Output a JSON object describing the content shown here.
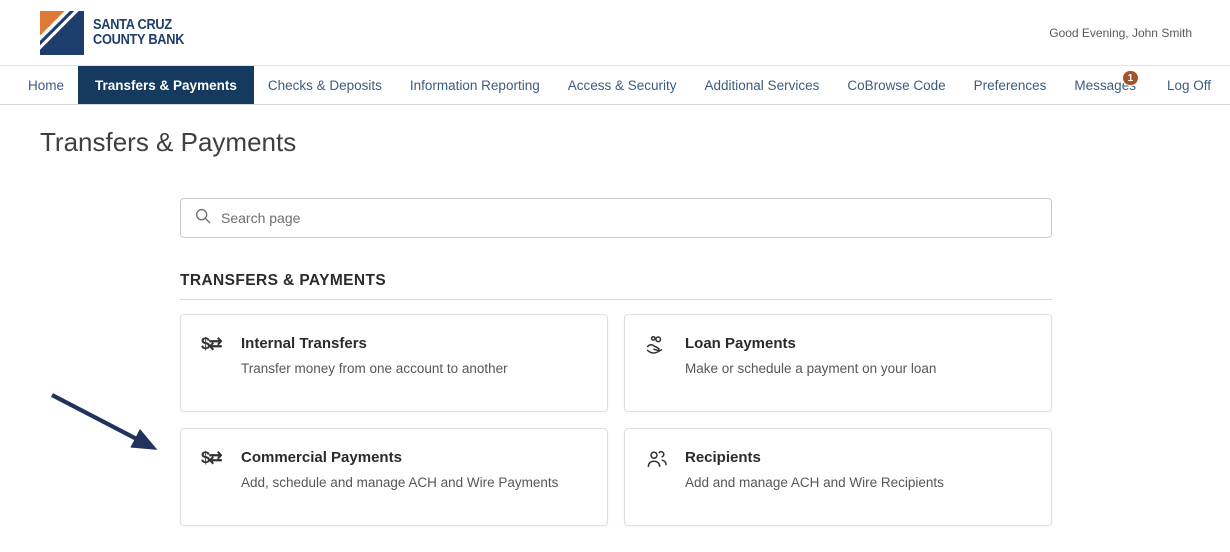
{
  "header": {
    "logo": {
      "line1": "SANTA CRUZ",
      "line2": "COUNTY BANK"
    },
    "greeting": "Good Evening, John Smith"
  },
  "nav": {
    "items": [
      {
        "label": "Home",
        "active": false
      },
      {
        "label": "Transfers & Payments",
        "active": true
      },
      {
        "label": "Checks & Deposits",
        "active": false
      },
      {
        "label": "Information Reporting",
        "active": false
      },
      {
        "label": "Access & Security",
        "active": false
      },
      {
        "label": "Additional Services",
        "active": false
      },
      {
        "label": "CoBrowse Code",
        "active": false
      },
      {
        "label": "Preferences",
        "active": false
      },
      {
        "label": "Messages",
        "active": false,
        "badge": "1"
      },
      {
        "label": "Log Off",
        "active": false
      }
    ]
  },
  "page": {
    "title": "Transfers & Payments"
  },
  "search": {
    "placeholder": "Search page"
  },
  "section": {
    "title": "TRANSFERS & PAYMENTS"
  },
  "cards": [
    {
      "icon": "dollar-transfer-icon",
      "glyph": "$⇄",
      "title": "Internal Transfers",
      "description": "Transfer money from one account to another"
    },
    {
      "icon": "hand-coins-icon",
      "title": "Loan Payments",
      "description": "Make or schedule a payment on your loan"
    },
    {
      "icon": "dollar-transfer-icon",
      "glyph": "$⇄",
      "title": "Commercial Payments",
      "description": "Add, schedule and manage ACH and Wire Payments"
    },
    {
      "icon": "people-icon",
      "title": "Recipients",
      "description": "Add and manage ACH and Wire Recipients"
    }
  ],
  "annotation": {
    "type": "arrow",
    "points_to": "Commercial Payments card"
  },
  "colors": {
    "brand_navy": "#16395f",
    "logo_navy": "#1d3e6d",
    "brand_orange": "#dd7a38",
    "badge_rust": "#a6522b",
    "arrow_navy": "#21325c"
  }
}
